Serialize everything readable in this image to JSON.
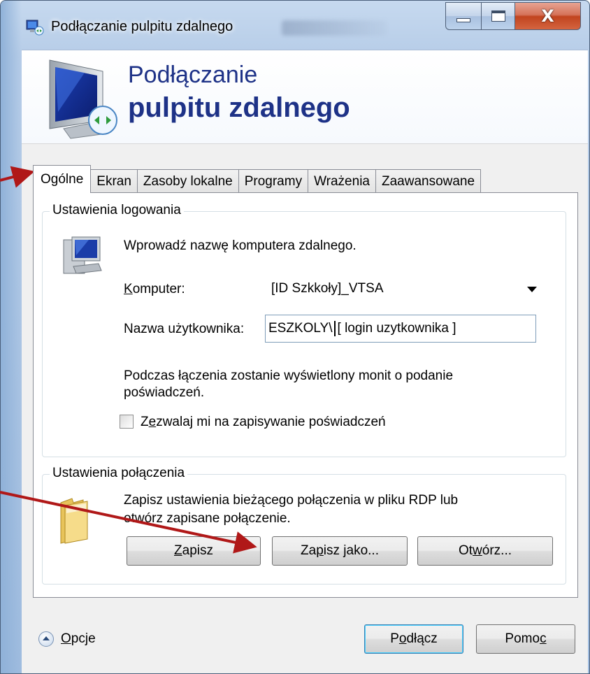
{
  "window": {
    "title": "Podłączanie pulpitu zdalnego",
    "close_glyph": "X"
  },
  "banner": {
    "line1": "Podłączanie",
    "line2": "pulpitu zdalnego"
  },
  "tabs": [
    {
      "label": "Ogólne",
      "active": true
    },
    {
      "label": "Ekran"
    },
    {
      "label": "Zasoby lokalne"
    },
    {
      "label": "Programy"
    },
    {
      "label": "Wrażenia"
    },
    {
      "label": "Zaawansowane"
    }
  ],
  "login_group": {
    "legend": "Ustawienia logowania",
    "intro": "Wprowadź nazwę komputera zdalnego.",
    "computer_label_underline": "K",
    "computer_label_rest": "omputer:",
    "computer_value": "[ID Szkkoły]_VTSA",
    "username_label": "Nazwa użytkownika:",
    "username_prefix": "ESZKOLY\\",
    "username_placeholder": "[ login uzytkownika ]",
    "info_line1": "Podczas łączenia zostanie wyświetlony monit o podanie",
    "info_line2": "poświadczeń.",
    "checkbox_pre": "Z",
    "checkbox_underline": "e",
    "checkbox_post": "zwalaj mi na zapisywanie poświadczeń"
  },
  "connection_group": {
    "legend": "Ustawienia połączenia",
    "info_line1": "Zapisz ustawienia bieżącego połączenia w pliku RDP lub",
    "info_line2": "otwórz zapisane połączenie.",
    "save_underline": "Z",
    "save_rest": "apisz",
    "saveas_pre": "Za",
    "saveas_underline": "p",
    "saveas_post": "isz jako...",
    "open_pre": "Ot",
    "open_underline": "w",
    "open_post": "órz..."
  },
  "footer": {
    "options_underline": "O",
    "options_rest": "pcje",
    "connect_pre": "P",
    "connect_underline": "o",
    "connect_post": "dłącz",
    "help_pre": "Pomo",
    "help_underline": "c"
  },
  "colors": {
    "banner_text": "#1e3287",
    "annotation_arrow": "#b01818"
  }
}
